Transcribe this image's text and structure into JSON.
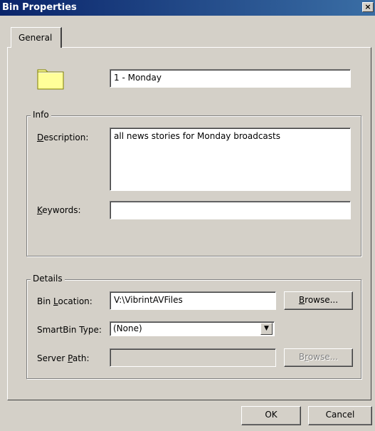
{
  "window": {
    "title": "Bin Properties",
    "close_glyph": "×"
  },
  "tabs": [
    {
      "label": "General"
    }
  ],
  "bin_name": {
    "value": "1 - Monday"
  },
  "info": {
    "legend": "Info",
    "description": {
      "label": "Description:",
      "value": "all news stories for Monday broadcasts"
    },
    "keywords": {
      "label": "Keywords:",
      "value": ""
    }
  },
  "details": {
    "legend": "Details",
    "bin_location": {
      "label": "Bin Location:",
      "value": "V:\\VibrintAVFiles",
      "browse_label": "Browse..."
    },
    "smartbin_type": {
      "label": "SmartBin Type:",
      "selected": "(None)"
    },
    "server_path": {
      "label": "Server Path:",
      "value": "",
      "browse_label": "Browse..."
    }
  },
  "footer": {
    "ok_label": "OK",
    "cancel_label": "Cancel"
  },
  "icons": {
    "folder": "folder-icon",
    "close": "close-icon",
    "dropdown": "chevron-down-icon"
  },
  "colors": {
    "titlebar_start": "#0a246a",
    "titlebar_end": "#3a6ea5",
    "face": "#d4d0c8",
    "folder": "#ffff99"
  }
}
